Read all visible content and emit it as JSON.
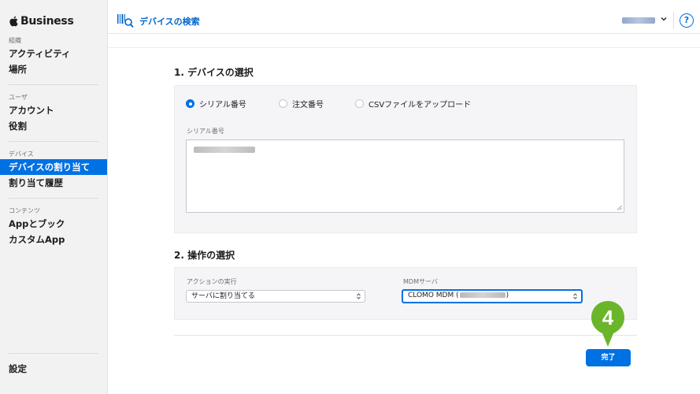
{
  "brand": {
    "name": "Business"
  },
  "sidebar": {
    "groups": [
      {
        "label": "組織",
        "items": [
          "アクティビティ",
          "場所"
        ]
      },
      {
        "label": "ユーザ",
        "items": [
          "アカウント",
          "役割"
        ]
      },
      {
        "label": "デバイス",
        "items": [
          "デバイスの割り当て",
          "割り当て履歴"
        ]
      },
      {
        "label": "コンテンツ",
        "items": [
          "Appとブック",
          "カスタムApp"
        ]
      }
    ],
    "active_item": "デバイスの割り当て",
    "settings_label": "設定"
  },
  "header": {
    "title": "デバイスの検索",
    "help_label": "?"
  },
  "section1": {
    "title": "1. デバイスの選択",
    "radio_options": [
      {
        "label": "シリアル番号",
        "selected": true
      },
      {
        "label": "注文番号",
        "selected": false
      },
      {
        "label": "CSVファイルをアップロード",
        "selected": false
      }
    ],
    "field_label": "シリアル番号"
  },
  "section2": {
    "title": "2. 操作の選択",
    "action": {
      "label": "アクションの実行",
      "value": "サーバに割り当てる"
    },
    "mdm": {
      "label": "MDMサーバ",
      "value_prefix": "CLOMO MDM (",
      "value_suffix": ")"
    }
  },
  "done_button": {
    "label": "完了"
  },
  "step_badge": {
    "number": "4"
  },
  "colors": {
    "accent": "#0071e3",
    "badge": "#6ab52a",
    "sidebar_bg": "#f2f2f2"
  }
}
